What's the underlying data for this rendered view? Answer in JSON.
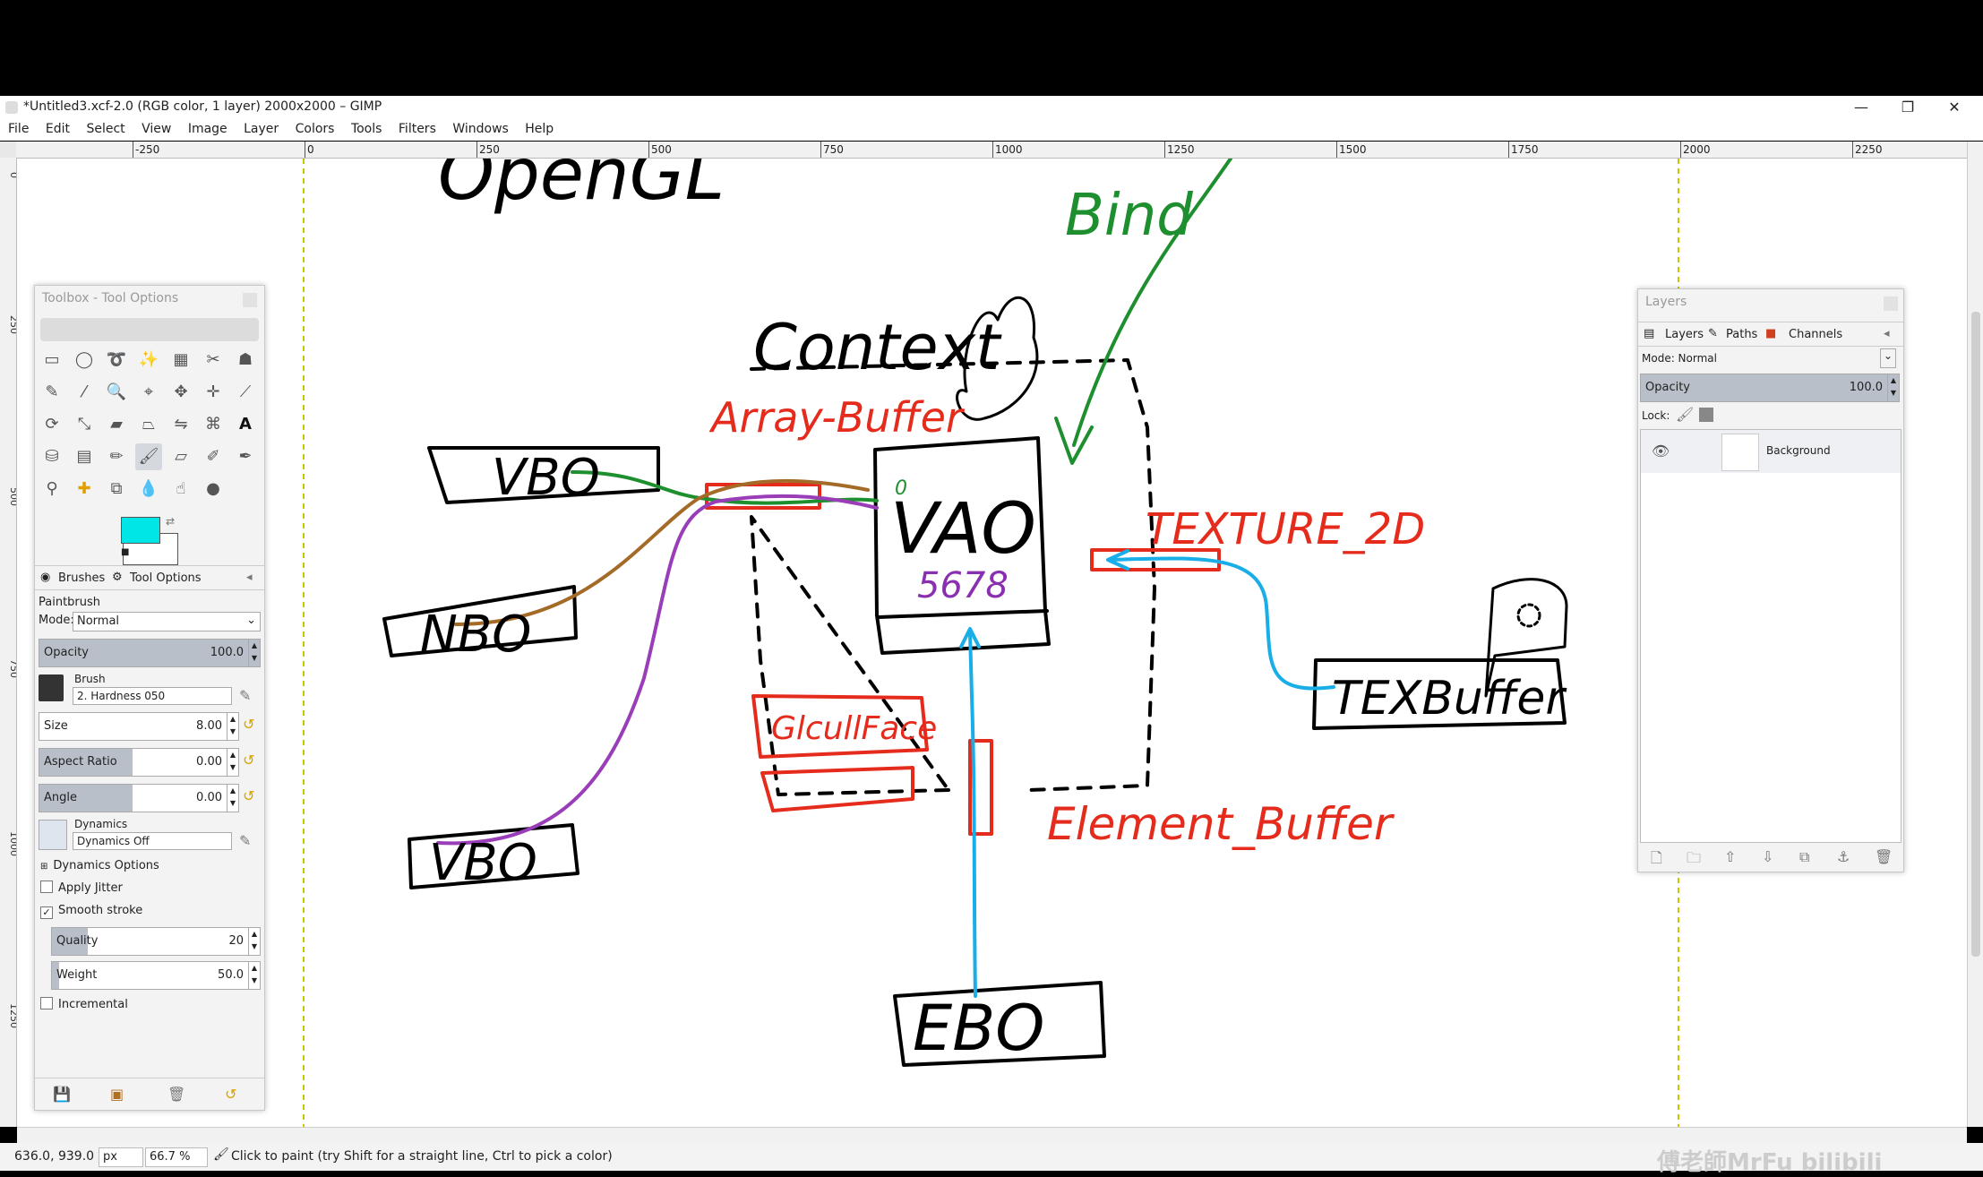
{
  "window": {
    "title": "*Untitled3.xcf-2.0 (RGB color, 1 layer) 2000x2000 – GIMP",
    "minimize": "—",
    "restore": "❐",
    "close": "✕"
  },
  "menu": [
    "File",
    "Edit",
    "Select",
    "View",
    "Image",
    "Layer",
    "Colors",
    "Tools",
    "Filters",
    "Windows",
    "Help"
  ],
  "ruler": {
    "ticks": [
      "-250",
      "0",
      "250",
      "500",
      "750",
      "1000",
      "1250",
      "1500",
      "1750",
      "2000",
      "2250"
    ],
    "vticks": [
      "0",
      "250",
      "500",
      "750",
      "1000",
      "1250"
    ]
  },
  "drawing": {
    "opengl": "OpenGL",
    "bind": "Bind",
    "context": "Context",
    "array_buffer": "Array-Buffer",
    "vbo1": "VBO",
    "nbo": "NBO",
    "vbo2": "VBO",
    "vao": "VAO",
    "vao_digits_left": "0",
    "vao_digits": "5678",
    "texture_2d": "TEXTURE_2D",
    "texbuffer": "TEXBuffer",
    "glcull": "GlcullFace",
    "element_buffer": "Element_Buffer",
    "ebo": "EBO"
  },
  "toolbox": {
    "title": "Toolbox - Tool Options",
    "fg_color": "#00e5e5",
    "tabs": [
      "Brushes",
      "Tool Options"
    ],
    "tool_name": "Paintbrush",
    "mode_label": "Mode:",
    "mode_value": "Normal",
    "opacity_label": "Opacity",
    "opacity_value": "100.0",
    "opacity_fraction": 1.0,
    "brush_label": "Brush",
    "brush_value": "2. Hardness 050",
    "size_label": "Size",
    "size_value": "8.00",
    "aspect_label": "Aspect Ratio",
    "aspect_value": "0.00",
    "angle_label": "Angle",
    "angle_value": "0.00",
    "dynamics_label": "Dynamics",
    "dynamics_value": "Dynamics Off",
    "dynamics_options": "Dynamics Options",
    "apply_jitter": "Apply Jitter",
    "smooth_stroke": "Smooth stroke",
    "quality_label": "Quality",
    "quality_value": "20",
    "weight_label": "Weight",
    "weight_value": "50.0",
    "incremental": "Incremental"
  },
  "layers": {
    "title": "Layers",
    "tabs": [
      "Layers",
      "Paths",
      "Channels"
    ],
    "mode_label": "Mode: Normal",
    "opacity_label": "Opacity",
    "opacity_value": "100.0",
    "lock_label": "Lock:",
    "layer_name": "Background"
  },
  "status": {
    "coords": "636.0, 939.0",
    "unit": "px",
    "zoom": "66.7 %",
    "message": "Click to paint (try Shift for a straight line, Ctrl to pick a color)"
  },
  "watermark": "傅老師MrFu bilibili"
}
